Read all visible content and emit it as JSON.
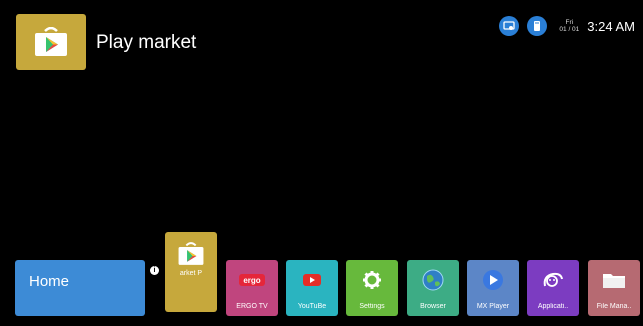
{
  "header": {
    "app_title": "Play market",
    "app_icon": "play-store-icon"
  },
  "status": {
    "day": "Fri",
    "date": "01 / 01",
    "time": "3:24 AM",
    "icons": [
      "network-icon",
      "usb-icon"
    ]
  },
  "dock": {
    "home_label": "Home",
    "info_badge": "i",
    "focused_app": {
      "label": "arket   P",
      "icon": "play-store-icon",
      "color": "#c6a83c"
    },
    "apps": [
      {
        "label": "ERGO TV",
        "icon": "ergo-icon",
        "color": "#c0457e"
      },
      {
        "label": "YouTuBe",
        "icon": "youtube-icon",
        "color": "#2ab4c0"
      },
      {
        "label": "Settings",
        "icon": "gear-icon",
        "color": "#67b93c"
      },
      {
        "label": "Browser",
        "icon": "globe-icon",
        "color": "#3dac85"
      },
      {
        "label": "MX Player",
        "icon": "play-icon",
        "color": "#5c86c7"
      },
      {
        "label": "Applicati..",
        "icon": "apps-icon",
        "color": "#7c3cc1"
      },
      {
        "label": "File Mana..",
        "icon": "folder-icon",
        "color": "#b66a72"
      }
    ]
  },
  "colors": {
    "background": "#000000",
    "home_tile": "#3d8bd6",
    "status_icon": "#2a7fd6"
  }
}
